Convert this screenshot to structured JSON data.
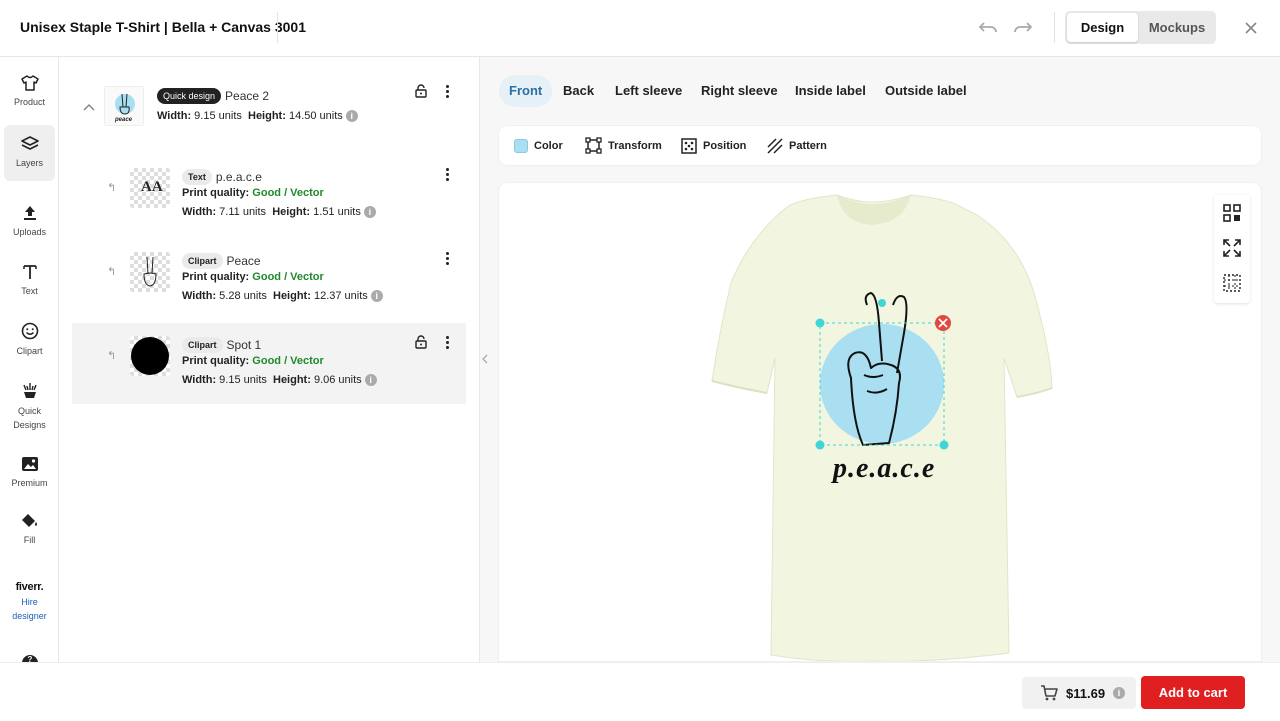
{
  "header": {
    "title": "Unisex Staple T-Shirt | Bella + Canvas 3001",
    "modes": [
      "Design",
      "Mockups"
    ],
    "active_mode": "Design"
  },
  "sidebar": {
    "items": [
      {
        "label": "Product",
        "icon": "shirt-icon"
      },
      {
        "label": "Layers",
        "icon": "layers-icon",
        "active": true
      },
      {
        "label": "Uploads",
        "icon": "upload-icon"
      },
      {
        "label": "Text",
        "icon": "text-icon"
      },
      {
        "label": "Clipart",
        "icon": "smiley-icon"
      },
      {
        "label": "Quick Designs",
        "icon": "quick-designs-icon"
      },
      {
        "label": "Premium",
        "icon": "premium-image-icon"
      },
      {
        "label": "Fill",
        "icon": "paint-bucket-icon"
      }
    ],
    "fiverr": {
      "logo": "fiverr.",
      "label": "Hire designer"
    }
  },
  "layers": [
    {
      "tag": "Quick design",
      "name": "Peace 2",
      "width_label": "Width:",
      "width": "9.15 units",
      "height_label": "Height:",
      "height": "14.50 units"
    },
    {
      "tag": "Text",
      "name": "p.e.a.c.e",
      "quality_label": "Print quality:",
      "quality": "Good / Vector",
      "width_label": "Width:",
      "width": "7.11 units",
      "height_label": "Height:",
      "height": "1.51 units"
    },
    {
      "tag": "Clipart",
      "name": "Peace",
      "quality_label": "Print quality:",
      "quality": "Good / Vector",
      "width_label": "Width:",
      "width": "5.28 units",
      "height_label": "Height:",
      "height": "12.37 units"
    },
    {
      "tag": "Clipart",
      "name": "Spot 1",
      "quality_label": "Print quality:",
      "quality": "Good / Vector",
      "width_label": "Width:",
      "width": "9.15 units",
      "height_label": "Height:",
      "height": "9.06 units"
    }
  ],
  "thumb_text": {
    "aa": "AA",
    "peace": "peace"
  },
  "tabs": [
    "Front",
    "Back",
    "Left sleeve",
    "Right sleeve",
    "Inside label",
    "Outside label"
  ],
  "active_tab": "Front",
  "toolbar": [
    "Color",
    "Transform",
    "Position",
    "Pattern"
  ],
  "canvas": {
    "design_text": "p.e.a.c.e",
    "shirt_color": "#f2f5df",
    "spot_color": "#a9dff0",
    "handle_color": "#3fd6d6",
    "delete_color": "#e0493f"
  },
  "footer": {
    "price": "$11.69",
    "add_to_cart": "Add to cart"
  },
  "colors": {
    "accent_tab": "#2b6fa3",
    "good": "#1f8a2a",
    "cart_button": "#e02020"
  }
}
